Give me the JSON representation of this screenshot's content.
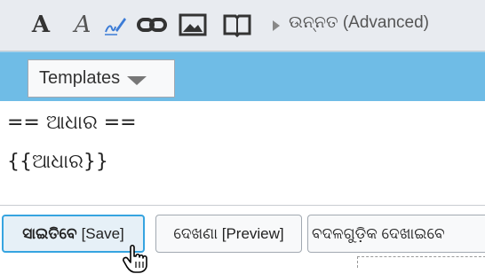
{
  "toolbar": {
    "bold_glyph": "A",
    "italic_glyph": "A",
    "icons": [
      "signature-icon",
      "link-icon",
      "image-icon",
      "book-icon"
    ],
    "advanced_label": "ଉନ୍ନତ (Advanced)"
  },
  "templates": {
    "label": "Templates"
  },
  "editor": {
    "line1": "== ଆଧାର ==",
    "line2": "{{ଆଧାର}}"
  },
  "actions": {
    "save_strong": "ସାଇତିବେ",
    "save_suffix": "[Save]",
    "preview_label": "ଦେଖଣା [Preview]",
    "changes_label": "ବଦଳଗୁଡ଼ିକ ଦେଖାଇବେ"
  },
  "colors": {
    "toolbar_bg": "#e8ebf0",
    "templates_bar_bg": "#6fbce6",
    "save_border": "#36a4e0"
  }
}
